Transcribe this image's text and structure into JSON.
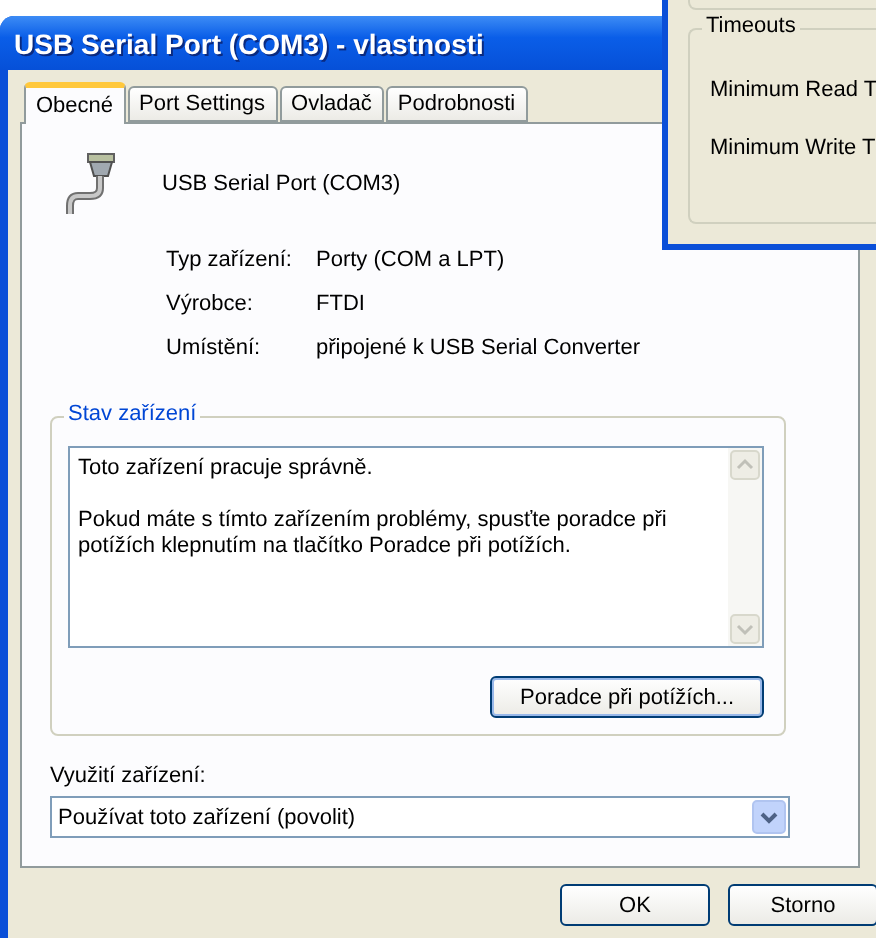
{
  "window": {
    "title": "USB Serial Port (COM3)  - vlastnosti"
  },
  "tabs": [
    {
      "label": "Obecné",
      "selected": true
    },
    {
      "label": "Port Settings",
      "selected": false
    },
    {
      "label": "Ovladač",
      "selected": false
    },
    {
      "label": "Podrobnosti",
      "selected": false
    }
  ],
  "device": {
    "name": "USB Serial Port (COM3)"
  },
  "properties": [
    {
      "label": "Typ zařízení:",
      "value": "Porty (COM a LPT)"
    },
    {
      "label": "Výrobce:",
      "value": "FTDI"
    },
    {
      "label": "Umístění:",
      "value": "připojené k USB Serial Converter"
    }
  ],
  "status_group": {
    "title": "Stav zařízení",
    "lines": [
      "Toto zařízení pracuje správně.",
      "Pokud máte s tímto zařízením problémy, spusťte poradce při potížích klepnutím na tlačítko Poradce při potížích."
    ],
    "button": "Poradce při potížích..."
  },
  "usage": {
    "label": "Využití zařízení:",
    "value": "Používat toto zařízení (povolit)"
  },
  "buttons": [
    "OK",
    "Storno"
  ],
  "back_window": {
    "group_title": "Timeouts",
    "labels": [
      "Minimum Read T",
      "Minimum Write T"
    ]
  }
}
